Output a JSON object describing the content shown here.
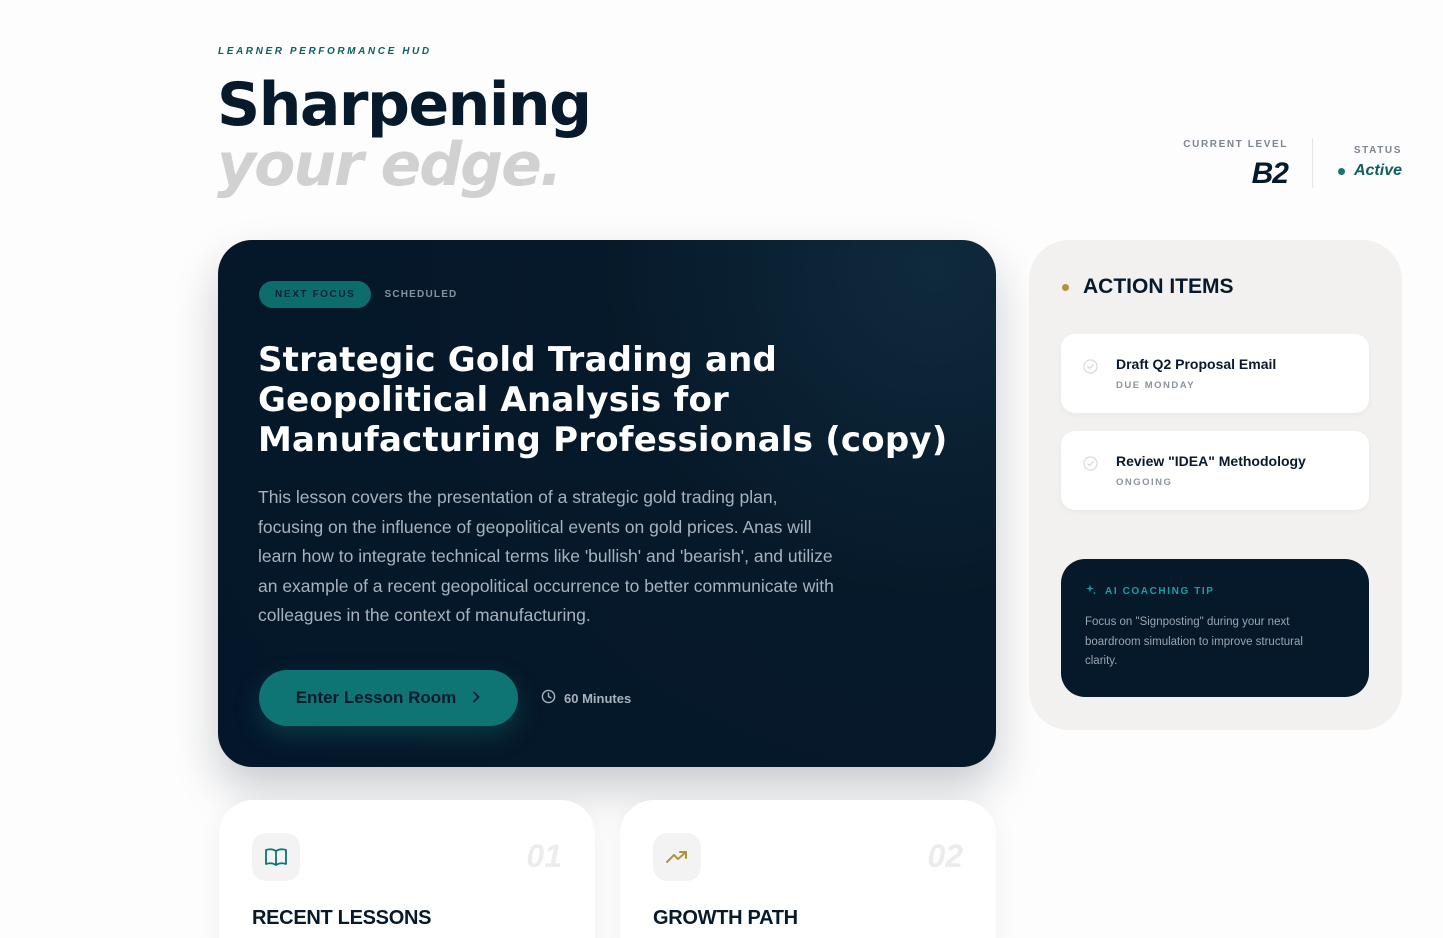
{
  "header": {
    "kicker": "LEARNER PERFORMANCE HUD",
    "title_line1": "Sharpening",
    "title_line2": "your edge.",
    "current_level_label": "CURRENT LEVEL",
    "current_level_value": "B2",
    "status_label": "STATUS",
    "status_value": "Active"
  },
  "hero": {
    "tag_primary": "NEXT FOCUS",
    "tag_secondary": "SCHEDULED",
    "title": "Strategic Gold Trading and Geopolitical Analysis for Manufacturing Professionals (copy)",
    "description": "This lesson covers the presentation of a strategic gold trading plan, focusing on the influence of geopolitical events on gold prices. Anas will learn how to integrate technical terms like 'bullish' and 'bearish', and utilize an example of a recent geopolitical occurrence to better communicate with colleagues in the context of manufacturing.",
    "button_label": "Enter Lesson Room",
    "duration": "60 Minutes"
  },
  "actions": {
    "header": "ACTION ITEMS",
    "items": [
      {
        "title": "Draft Q2 Proposal Email",
        "sub": "DUE MONDAY"
      },
      {
        "title": "Review \"IDEA\" Methodology",
        "sub": "ONGOING"
      }
    ],
    "coach_header": "AI COACHING TIP",
    "coach_text": "Focus on \"Signposting\" during your next boardroom simulation to improve structural clarity."
  },
  "cards": [
    {
      "number": "01",
      "title": "RECENT LESSONS",
      "icon": "book-open-icon"
    },
    {
      "number": "02",
      "title": "GROWTH PATH",
      "icon": "trending-up-icon"
    }
  ],
  "colors": {
    "accent_teal": "#0e7474",
    "navy": "#06192a",
    "gold": "#b3923c",
    "muted_title": "#d1d1d1"
  }
}
